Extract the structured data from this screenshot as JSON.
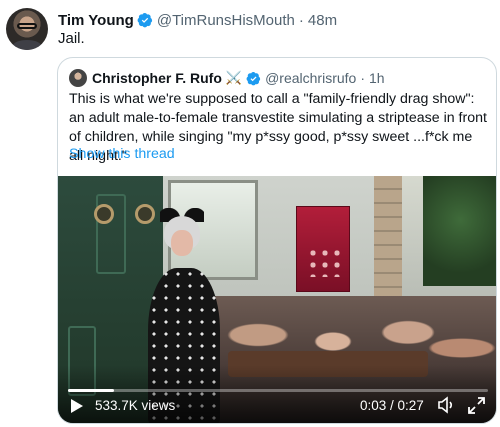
{
  "tweet": {
    "author_name": "Tim Young",
    "handle": "@TimRunsHisMouth",
    "separator": "·",
    "time": "48m",
    "text": "Jail."
  },
  "quoted": {
    "author_name": "Christopher F. Rufo",
    "badge": "⚔️",
    "handle": "@realchrisrufo",
    "separator": "·",
    "time": "1h",
    "text": "This is what we're supposed to call a \"family-friendly drag show\": an adult male-to-female transvestite simulating a striptease in front of children, while singing \"my p*ssy good, p*ssy sweet ...f*ck me all night.\"",
    "show_thread": "Show this thread"
  },
  "video": {
    "views": "533.7K views",
    "time": "0:03 / 0:27",
    "progress_fraction": 0.11
  },
  "colors": {
    "verified": "#1d9bf0",
    "link": "#1d9bf0",
    "muted": "#536471"
  },
  "icons": [
    "verified-badge-icon",
    "play-icon",
    "volume-icon",
    "fullscreen-icon"
  ]
}
